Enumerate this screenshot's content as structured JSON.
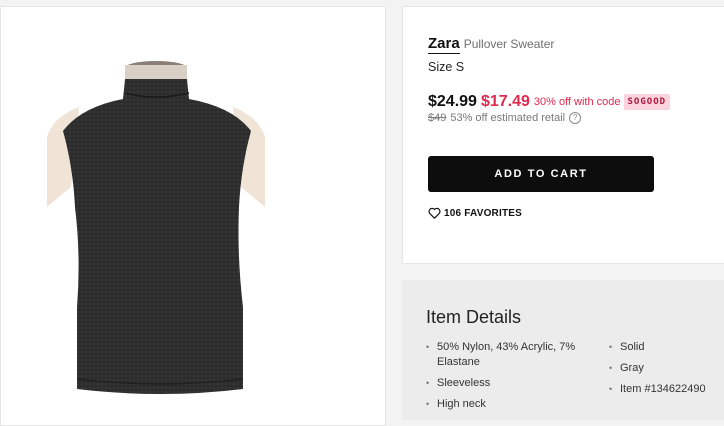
{
  "product": {
    "brand": "Zara",
    "category": "Pullover Sweater",
    "size_label": "Size S",
    "image_alt": "sleeveless-mock-neck-sweater",
    "price": "$24.99",
    "sale_price": "$17.49",
    "promo_text": "30% off with code",
    "promo_code": "SOGOOD",
    "retail_price": "$49",
    "retail_label": "53% off estimated retail",
    "info_icon_glyph": "?"
  },
  "actions": {
    "add_to_cart_label": "ADD TO CART",
    "favorites_label": "106 FAVORITES"
  },
  "details": {
    "title": "Item Details",
    "col1": [
      "50% Nylon, 43% Acrylic, 7% Elastane",
      "Sleeveless",
      "High neck"
    ],
    "col2": [
      "Solid",
      "Gray",
      "Item #134622490"
    ],
    "bullet": "•"
  },
  "icons": {
    "favorites": "heart-outline-icon",
    "retail_info": "question-circle-icon"
  },
  "colors": {
    "sale": "#e0294d",
    "promo_bg": "#fbd3dd",
    "button": "#0d0d0d",
    "garment": "#2c2c2c"
  }
}
